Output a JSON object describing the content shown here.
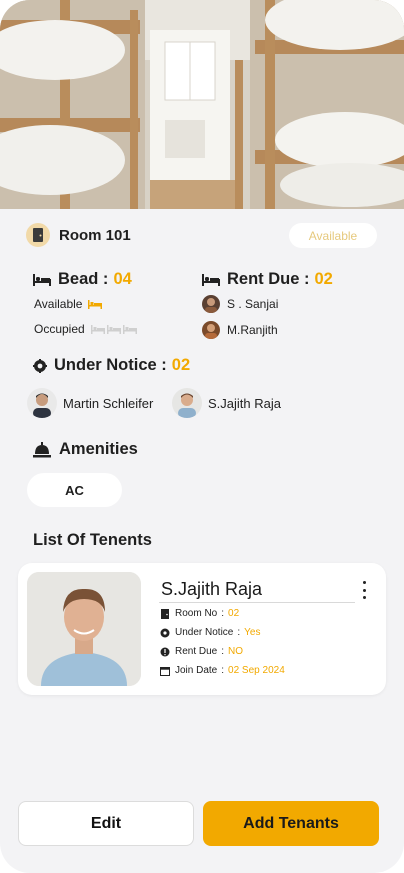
{
  "room": {
    "title": "Room 101",
    "status": "Available"
  },
  "bead": {
    "label": "Bead :",
    "count": "04",
    "available_label": "Available",
    "occupied_label": "Occupied",
    "available_beds": 1,
    "occupied_beds": 3
  },
  "rent_due": {
    "label": "Rent Due :",
    "count": "02",
    "people": [
      "S . Sanjai",
      "M.Ranjith"
    ]
  },
  "under_notice": {
    "label": "Under Notice :",
    "count": "02",
    "people": [
      "Martin Schleifer",
      "S.Jajith Raja"
    ]
  },
  "amenities": {
    "label": "Amenities",
    "items": [
      "AC"
    ]
  },
  "tenants": {
    "title": "List Of Tenents",
    "list": [
      {
        "name": "S.Jajith Raja",
        "room_no_label": "Room No",
        "room_no": "02",
        "under_notice_label": "Under Notice",
        "under_notice": "Yes",
        "rent_due_label": "Rent Due",
        "rent_due": "NO",
        "join_date_label": "Join Date",
        "join_date": "02 Sep 2024"
      }
    ]
  },
  "actions": {
    "edit_label": "Edit",
    "add_label": "Add Tenants"
  },
  "colors": {
    "accent": "#f2a900",
    "background": "#f3f3f5",
    "status_available": "#e6c97d"
  },
  "icons": [
    "door-icon",
    "bed-icon",
    "gear-badge-icon",
    "service-bell-icon",
    "more-vertical-icon",
    "door-small-icon",
    "alert-icon",
    "calendar-icon"
  ]
}
